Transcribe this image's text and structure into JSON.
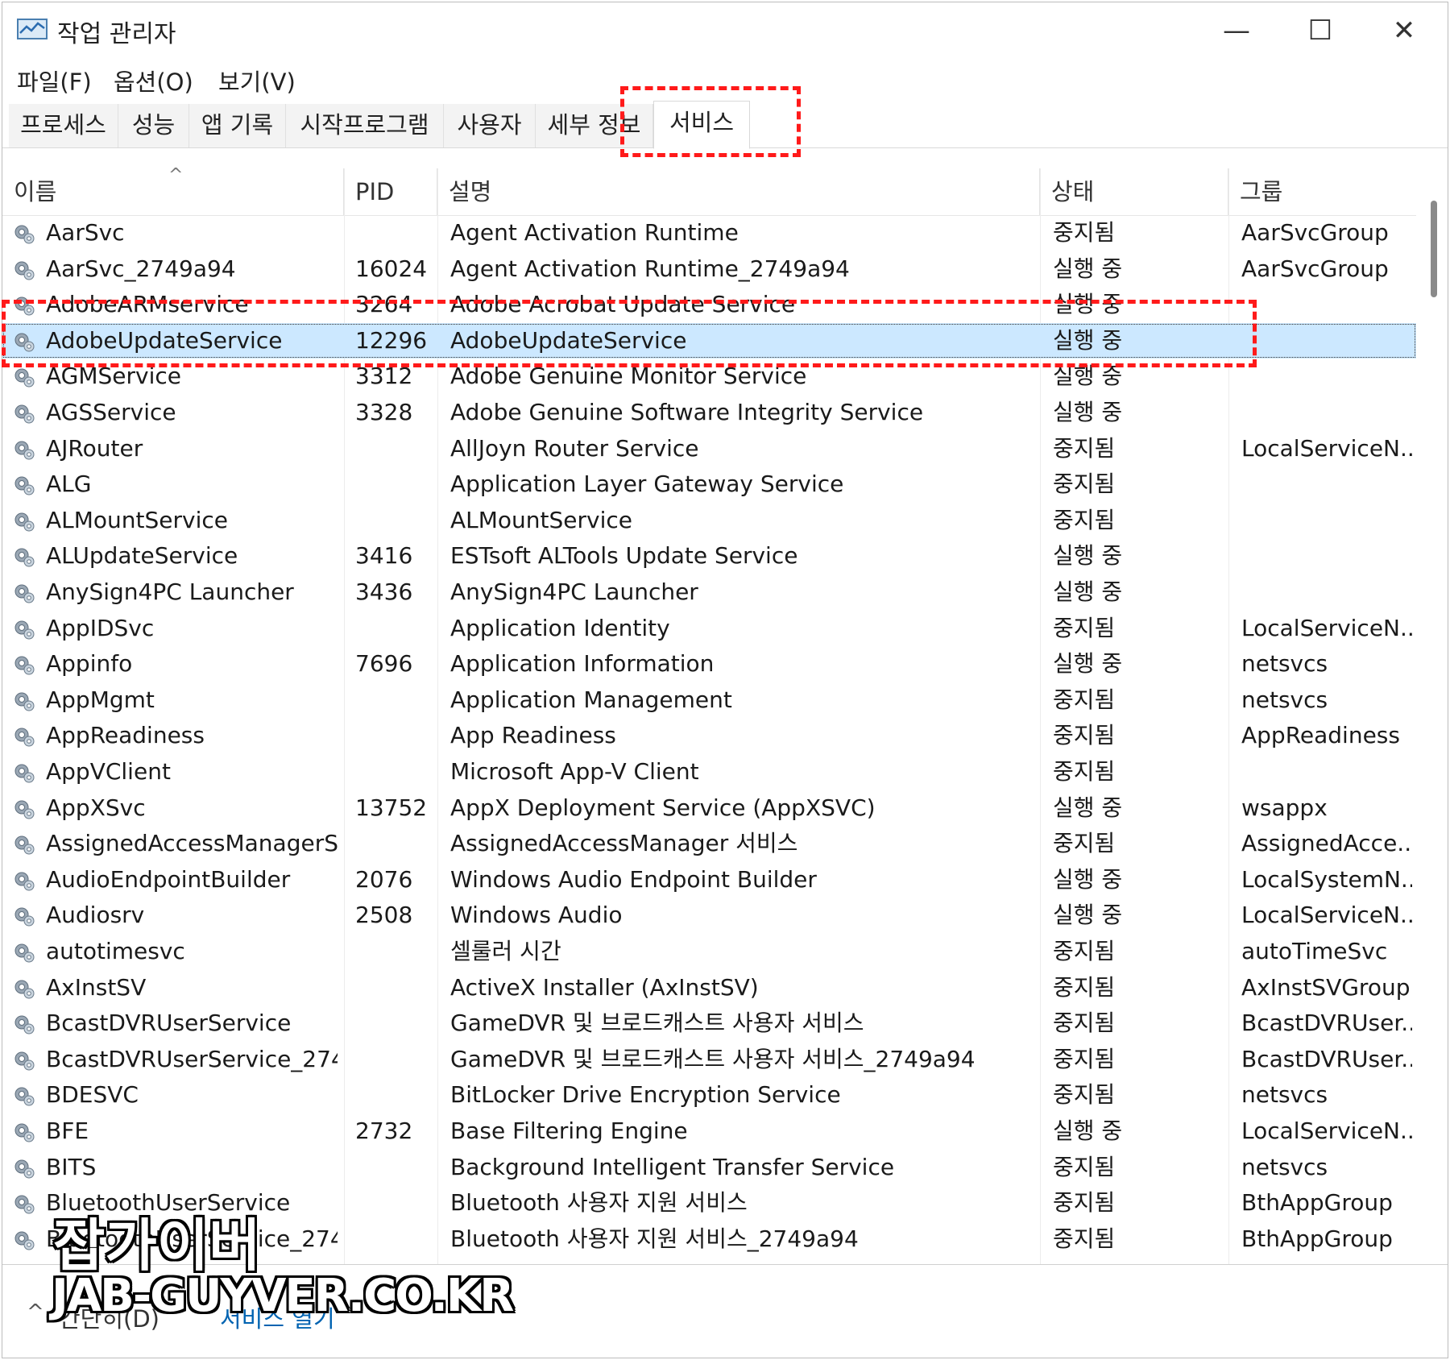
{
  "window": {
    "title": "작업 관리자",
    "controls": {
      "minimize": "—",
      "maximize": "☐",
      "close": "✕"
    }
  },
  "menu": {
    "items": [
      "파일(F)",
      "옵션(O)",
      "보기(V)"
    ]
  },
  "tabs": {
    "items": [
      "프로세스",
      "성능",
      "앱 기록",
      "시작프로그램",
      "사용자",
      "세부 정보",
      "서비스"
    ],
    "active": "서비스"
  },
  "table": {
    "columns": [
      "이름",
      "PID",
      "설명",
      "상태",
      "그룹"
    ],
    "sort_indicator": "^",
    "selected_row": "AdobeUpdateService",
    "rows": [
      {
        "name": "AarSvc",
        "pid": "",
        "desc": "Agent Activation Runtime",
        "status": "중지됨",
        "group": "AarSvcGroup"
      },
      {
        "name": "AarSvc_2749a94",
        "pid": "16024",
        "desc": "Agent Activation Runtime_2749a94",
        "status": "실행 중",
        "group": "AarSvcGroup"
      },
      {
        "name": "AdobeARMservice",
        "pid": "3264",
        "desc": "Adobe Acrobat Update Service",
        "status": "실행 중",
        "group": ""
      },
      {
        "name": "AdobeUpdateService",
        "pid": "12296",
        "desc": "AdobeUpdateService",
        "status": "실행 중",
        "group": ""
      },
      {
        "name": "AGMService",
        "pid": "3312",
        "desc": "Adobe Genuine Monitor Service",
        "status": "실행 중",
        "group": ""
      },
      {
        "name": "AGSService",
        "pid": "3328",
        "desc": "Adobe Genuine Software Integrity Service",
        "status": "실행 중",
        "group": ""
      },
      {
        "name": "AJRouter",
        "pid": "",
        "desc": "AllJoyn Router Service",
        "status": "중지됨",
        "group": "LocalServiceN..."
      },
      {
        "name": "ALG",
        "pid": "",
        "desc": "Application Layer Gateway Service",
        "status": "중지됨",
        "group": ""
      },
      {
        "name": "ALMountService",
        "pid": "",
        "desc": "ALMountService",
        "status": "중지됨",
        "group": ""
      },
      {
        "name": "ALUpdateService",
        "pid": "3416",
        "desc": "ESTsoft ALTools Update Service",
        "status": "실행 중",
        "group": ""
      },
      {
        "name": "AnySign4PC Launcher",
        "pid": "3436",
        "desc": "AnySign4PC Launcher",
        "status": "실행 중",
        "group": ""
      },
      {
        "name": "AppIDSvc",
        "pid": "",
        "desc": "Application Identity",
        "status": "중지됨",
        "group": "LocalServiceN..."
      },
      {
        "name": "Appinfo",
        "pid": "7696",
        "desc": "Application Information",
        "status": "실행 중",
        "group": "netsvcs"
      },
      {
        "name": "AppMgmt",
        "pid": "",
        "desc": "Application Management",
        "status": "중지됨",
        "group": "netsvcs"
      },
      {
        "name": "AppReadiness",
        "pid": "",
        "desc": "App Readiness",
        "status": "중지됨",
        "group": "AppReadiness"
      },
      {
        "name": "AppVClient",
        "pid": "",
        "desc": "Microsoft App-V Client",
        "status": "중지됨",
        "group": ""
      },
      {
        "name": "AppXSvc",
        "pid": "13752",
        "desc": "AppX Deployment Service (AppXSVC)",
        "status": "실행 중",
        "group": "wsappx"
      },
      {
        "name": "AssignedAccessManagerSvc",
        "pid": "",
        "desc": "AssignedAccessManager 서비스",
        "status": "중지됨",
        "group": "AssignedAcce..."
      },
      {
        "name": "AudioEndpointBuilder",
        "pid": "2076",
        "desc": "Windows Audio Endpoint Builder",
        "status": "실행 중",
        "group": "LocalSystemN..."
      },
      {
        "name": "Audiosrv",
        "pid": "2508",
        "desc": "Windows Audio",
        "status": "실행 중",
        "group": "LocalServiceN..."
      },
      {
        "name": "autotimesvc",
        "pid": "",
        "desc": "셀룰러 시간",
        "status": "중지됨",
        "group": "autoTimeSvc"
      },
      {
        "name": "AxInstSV",
        "pid": "",
        "desc": "ActiveX Installer (AxInstSV)",
        "status": "중지됨",
        "group": "AxInstSVGroup"
      },
      {
        "name": "BcastDVRUserService",
        "pid": "",
        "desc": "GameDVR 및 브로드캐스트 사용자 서비스",
        "status": "중지됨",
        "group": "BcastDVRUser..."
      },
      {
        "name": "BcastDVRUserService_274...",
        "pid": "",
        "desc": "GameDVR 및 브로드캐스트 사용자 서비스_2749a94",
        "status": "중지됨",
        "group": "BcastDVRUser..."
      },
      {
        "name": "BDESVC",
        "pid": "",
        "desc": "BitLocker Drive Encryption Service",
        "status": "중지됨",
        "group": "netsvcs"
      },
      {
        "name": "BFE",
        "pid": "2732",
        "desc": "Base Filtering Engine",
        "status": "실행 중",
        "group": "LocalServiceN..."
      },
      {
        "name": "BITS",
        "pid": "",
        "desc": "Background Intelligent Transfer Service",
        "status": "중지됨",
        "group": "netsvcs"
      },
      {
        "name": "BluetoothUserService",
        "pid": "",
        "desc": "Bluetooth 사용자 지원 서비스",
        "status": "중지됨",
        "group": "BthAppGroup"
      },
      {
        "name": "BluetoothUserService_274...",
        "pid": "",
        "desc": "Bluetooth 사용자 지원 서비스_2749a94",
        "status": "중지됨",
        "group": "BthAppGroup"
      }
    ]
  },
  "footer": {
    "chevron": "^",
    "fewer_details": "간단히(D)",
    "open_services": "서비스 열기"
  },
  "watermark": {
    "line1": "잡가이버",
    "line2": "JAB-GUYVER.CO.KR"
  },
  "colors": {
    "selection": "#cce8ff",
    "highlight_box": "#ff1a1a",
    "link": "#0063b1"
  }
}
